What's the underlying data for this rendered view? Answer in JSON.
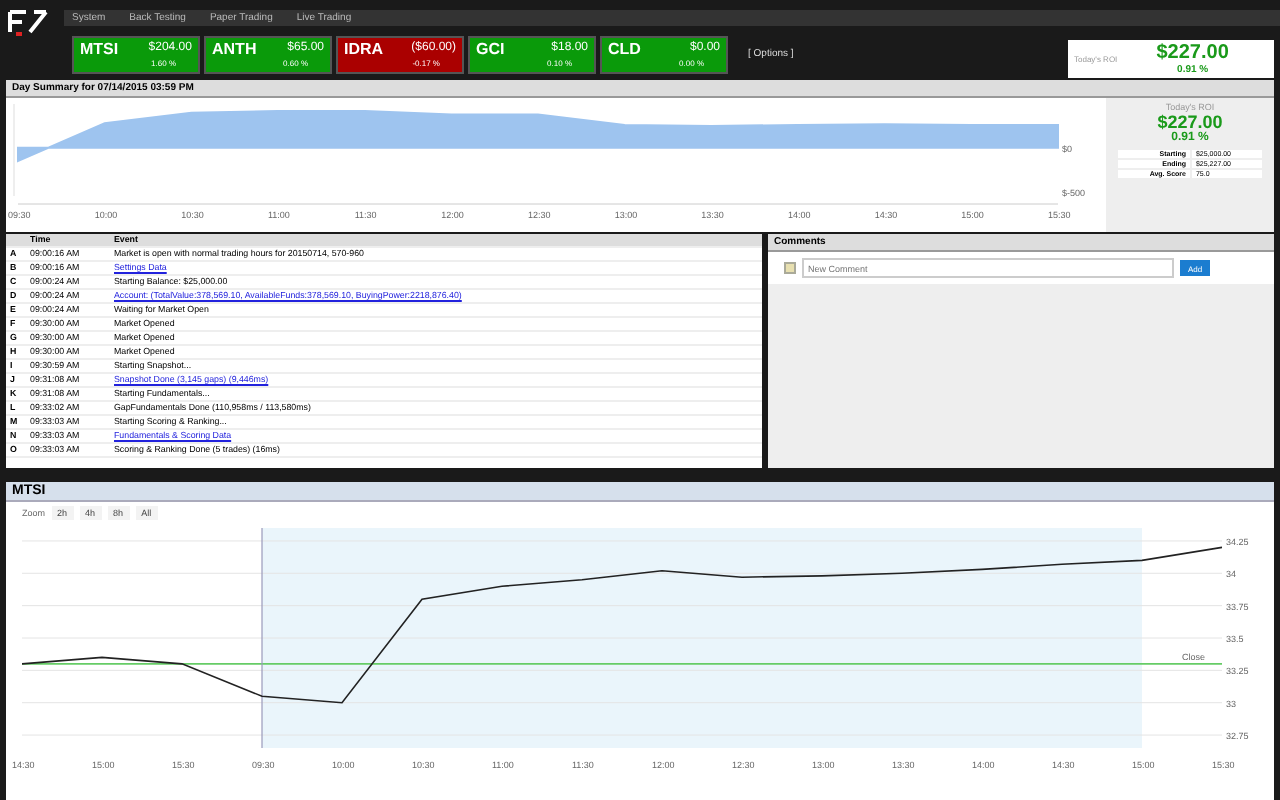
{
  "menu": [
    {
      "label": "System"
    },
    {
      "label": "Back Testing"
    },
    {
      "label": "Paper Trading"
    },
    {
      "label": "Live Trading"
    }
  ],
  "tickers": [
    {
      "symbol": "MTSI",
      "amount": "$204.00",
      "percent": "1.60 %",
      "gain": true
    },
    {
      "symbol": "ANTH",
      "amount": "$65.00",
      "percent": "0.60 %",
      "gain": true
    },
    {
      "symbol": "IDRA",
      "amount": "($60.00)",
      "percent": "-0.17 %",
      "gain": false
    },
    {
      "symbol": "GCI",
      "amount": "$18.00",
      "percent": "0.10 %",
      "gain": true
    },
    {
      "symbol": "CLD",
      "amount": "$0.00",
      "percent": "0.00 %",
      "gain": true
    }
  ],
  "options_link": "[ Options ]",
  "roi_header": {
    "label": "Today's ROI",
    "amount": "$227.00",
    "percent": "0.91 %"
  },
  "day_summary": {
    "title": "Day Summary for 07/14/2015 03:59 PM",
    "chart_data": {
      "type": "area",
      "categories": [
        "09:30",
        "10:00",
        "10:30",
        "11:00",
        "11:30",
        "12:00",
        "12:30",
        "13:00",
        "13:30",
        "14:00",
        "14:30",
        "15:00",
        "15:30"
      ],
      "ylim": [
        -550,
        500
      ],
      "yticks": [
        {
          "value": 0,
          "label": "$0"
        },
        {
          "value": -500,
          "label": "$-500"
        }
      ],
      "series": [
        {
          "color": "#9ec4ef",
          "values": [
            -150,
            280,
            400,
            420,
            420,
            380,
            380,
            260,
            250,
            260,
            270,
            260,
            260
          ]
        }
      ]
    },
    "roi": {
      "label": "Today's ROI",
      "amount": "$227.00",
      "percent": "0.91 %"
    },
    "stats": [
      {
        "label": "Starting",
        "value": "$25,000.00"
      },
      {
        "label": "Ending",
        "value": "$25,227.00"
      },
      {
        "label": "Avg. Score",
        "value": "75.0"
      }
    ]
  },
  "events": {
    "columns": [
      "Time",
      "Event"
    ],
    "rows": [
      {
        "key": "A",
        "time": "09:00:16 AM",
        "event": "Market is open with normal trading hours for 20150714, 570-960",
        "link": false
      },
      {
        "key": "B",
        "time": "09:00:16 AM",
        "event": "Settings Data",
        "link": true
      },
      {
        "key": "C",
        "time": "09:00:24 AM",
        "event": "Starting Balance: $25,000.00",
        "link": false
      },
      {
        "key": "D",
        "time": "09:00:24 AM",
        "event": "Account: (TotalValue:378,569.10, AvailableFunds:378,569.10, BuyingPower:2218,876.40)",
        "link": true
      },
      {
        "key": "E",
        "time": "09:00:24 AM",
        "event": "Waiting for Market Open",
        "link": false
      },
      {
        "key": "F",
        "time": "09:30:00 AM",
        "event": "Market Opened",
        "link": false
      },
      {
        "key": "G",
        "time": "09:30:00 AM",
        "event": "Market Opened",
        "link": false
      },
      {
        "key": "H",
        "time": "09:30:00 AM",
        "event": "Market Opened",
        "link": false
      },
      {
        "key": "I",
        "time": "09:30:59 AM",
        "event": "Starting Snapshot...",
        "link": false
      },
      {
        "key": "J",
        "time": "09:31:08 AM",
        "event": "Snapshot Done (3,145 gaps) (9,446ms)",
        "link": true
      },
      {
        "key": "K",
        "time": "09:31:08 AM",
        "event": "Starting Fundamentals...",
        "link": false
      },
      {
        "key": "L",
        "time": "09:33:02 AM",
        "event": "GapFundamentals Done (110,958ms / 113,580ms)",
        "link": false
      },
      {
        "key": "M",
        "time": "09:33:03 AM",
        "event": "Starting Scoring & Ranking...",
        "link": false
      },
      {
        "key": "N",
        "time": "09:33:03 AM",
        "event": "Fundamentals & Scoring Data",
        "link": true
      },
      {
        "key": "O",
        "time": "09:33:03 AM",
        "event": "Scoring & Ranking Done (5 trades) (16ms)",
        "link": false
      }
    ]
  },
  "comments": {
    "title": "Comments",
    "placeholder": "New Comment",
    "button": "Add"
  },
  "stock": {
    "title": "MTSI",
    "zoom_label": "Zoom",
    "zoom_buttons": [
      {
        "label": "2h",
        "selected": false
      },
      {
        "label": "4h",
        "selected": false
      },
      {
        "label": "8h",
        "selected": false
      },
      {
        "label": "All",
        "selected": false
      }
    ],
    "close_label": "Close",
    "chart_data": {
      "type": "line",
      "categories": [
        "14:30",
        "15:00",
        "15:30",
        "09:30",
        "10:00",
        "10:30",
        "11:00",
        "11:30",
        "12:00",
        "12:30",
        "13:00",
        "13:30",
        "14:00",
        "14:30",
        "15:00",
        "15:30"
      ],
      "ylim": [
        32.65,
        34.35
      ],
      "yticks": [
        32.75,
        33,
        33.25,
        33.5,
        33.75,
        34,
        34.25
      ],
      "grid": true,
      "ref_lines": [
        {
          "axis": "y",
          "value": 33.3,
          "color": "#66cc66"
        },
        {
          "axis": "x",
          "value": "09:30",
          "color": "#9999bb"
        }
      ],
      "series": [
        {
          "color": "#222222",
          "values": [
            33.3,
            33.35,
            33.3,
            33.05,
            33.0,
            33.8,
            33.9,
            33.95,
            34.02,
            33.97,
            33.98,
            34.0,
            34.03,
            34.07,
            34.1,
            34.2
          ]
        }
      ]
    }
  }
}
